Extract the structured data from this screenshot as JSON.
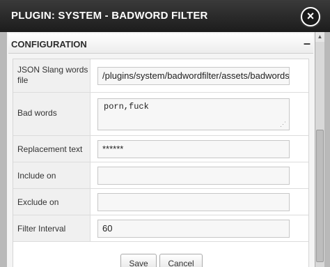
{
  "dialog": {
    "title": "PLUGIN: SYSTEM - BADWORD FILTER",
    "close_symbol": "×"
  },
  "section": {
    "title": "CONFIGURATION",
    "collapse_symbol": "–"
  },
  "fields": [
    {
      "label": "JSON Slang words file",
      "value": "/plugins/system/badwordfilter/assets/badwords.j"
    },
    {
      "label": "Bad words",
      "value": "porn,fuck"
    },
    {
      "label": "Replacement text",
      "value": "******"
    },
    {
      "label": "Include on",
      "value": ""
    },
    {
      "label": "Exclude on",
      "value": ""
    },
    {
      "label": "Filter Interval",
      "value": "60"
    }
  ],
  "buttons": {
    "save": "Save",
    "cancel": "Cancel"
  },
  "scroll_up_symbol": "▲"
}
